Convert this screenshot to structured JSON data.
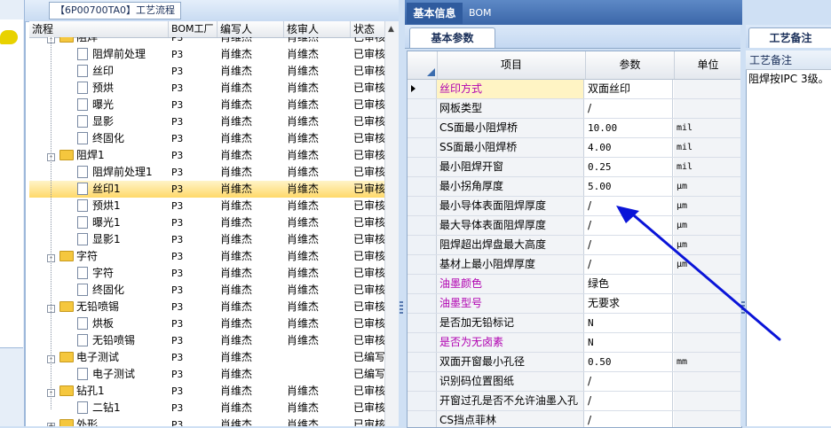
{
  "tree_panel": {
    "caption": "【6P00700TA0】工艺流程",
    "columns": [
      "流程",
      "BOM工厂",
      "编写人",
      "核审人",
      "状态"
    ],
    "rows": [
      {
        "level": 1,
        "type": "folder",
        "expand": "-",
        "name": "阻焊",
        "factory": "P3",
        "writer": "肖维杰",
        "reviewer": "肖维杰",
        "status": "已审核"
      },
      {
        "level": 2,
        "type": "doc",
        "name": "阻焊前处理",
        "factory": "P3",
        "writer": "肖维杰",
        "reviewer": "肖维杰",
        "status": "已审核"
      },
      {
        "level": 2,
        "type": "doc",
        "name": "丝印",
        "factory": "P3",
        "writer": "肖维杰",
        "reviewer": "肖维杰",
        "status": "已审核"
      },
      {
        "level": 2,
        "type": "doc",
        "name": "预烘",
        "factory": "P3",
        "writer": "肖维杰",
        "reviewer": "肖维杰",
        "status": "已审核"
      },
      {
        "level": 2,
        "type": "doc",
        "name": "曝光",
        "factory": "P3",
        "writer": "肖维杰",
        "reviewer": "肖维杰",
        "status": "已审核"
      },
      {
        "level": 2,
        "type": "doc",
        "name": "显影",
        "factory": "P3",
        "writer": "肖维杰",
        "reviewer": "肖维杰",
        "status": "已审核"
      },
      {
        "level": 2,
        "type": "doc",
        "name": "终固化",
        "factory": "P3",
        "writer": "肖维杰",
        "reviewer": "肖维杰",
        "status": "已审核"
      },
      {
        "level": 1,
        "type": "folder",
        "expand": "-",
        "name": "阻焊1",
        "factory": "P3",
        "writer": "肖维杰",
        "reviewer": "肖维杰",
        "status": "已审核"
      },
      {
        "level": 2,
        "type": "doc",
        "name": "阻焊前处理1",
        "factory": "P3",
        "writer": "肖维杰",
        "reviewer": "肖维杰",
        "status": "已审核"
      },
      {
        "level": 2,
        "type": "doc",
        "name": "丝印1",
        "factory": "P3",
        "writer": "肖维杰",
        "reviewer": "肖维杰",
        "status": "已审核",
        "selected": true
      },
      {
        "level": 2,
        "type": "doc",
        "name": "预烘1",
        "factory": "P3",
        "writer": "肖维杰",
        "reviewer": "肖维杰",
        "status": "已审核"
      },
      {
        "level": 2,
        "type": "doc",
        "name": "曝光1",
        "factory": "P3",
        "writer": "肖维杰",
        "reviewer": "肖维杰",
        "status": "已审核"
      },
      {
        "level": 2,
        "type": "doc",
        "name": "显影1",
        "factory": "P3",
        "writer": "肖维杰",
        "reviewer": "肖维杰",
        "status": "已审核"
      },
      {
        "level": 1,
        "type": "folder",
        "expand": "-",
        "name": "字符",
        "factory": "P3",
        "writer": "肖维杰",
        "reviewer": "肖维杰",
        "status": "已审核"
      },
      {
        "level": 2,
        "type": "doc",
        "name": "字符",
        "factory": "P3",
        "writer": "肖维杰",
        "reviewer": "肖维杰",
        "status": "已审核"
      },
      {
        "level": 2,
        "type": "doc",
        "name": "终固化",
        "factory": "P3",
        "writer": "肖维杰",
        "reviewer": "肖维杰",
        "status": "已审核"
      },
      {
        "level": 1,
        "type": "folder",
        "expand": "-",
        "name": "无铅喷锡",
        "factory": "P3",
        "writer": "肖维杰",
        "reviewer": "肖维杰",
        "status": "已审核"
      },
      {
        "level": 2,
        "type": "doc",
        "name": "烘板",
        "factory": "P3",
        "writer": "肖维杰",
        "reviewer": "肖维杰",
        "status": "已审核"
      },
      {
        "level": 2,
        "type": "doc",
        "name": "无铅喷锡",
        "factory": "P3",
        "writer": "肖维杰",
        "reviewer": "肖维杰",
        "status": "已审核"
      },
      {
        "level": 1,
        "type": "folder",
        "expand": "-",
        "name": "电子测试",
        "factory": "P3",
        "writer": "肖维杰",
        "reviewer": "",
        "status": "已编写"
      },
      {
        "level": 2,
        "type": "doc",
        "name": "电子测试",
        "factory": "P3",
        "writer": "肖维杰",
        "reviewer": "",
        "status": "已编写"
      },
      {
        "level": 1,
        "type": "folder",
        "expand": "-",
        "name": "钻孔1",
        "factory": "P3",
        "writer": "肖维杰",
        "reviewer": "肖维杰",
        "status": "已审核"
      },
      {
        "level": 2,
        "type": "doc",
        "name": "二钻1",
        "factory": "P3",
        "writer": "肖维杰",
        "reviewer": "肖维杰",
        "status": "已审核"
      },
      {
        "level": 1,
        "type": "folder",
        "expand": "+",
        "name": "外形",
        "factory": "P3",
        "writer": "肖维杰",
        "reviewer": "肖维杰",
        "status": "已审核"
      }
    ]
  },
  "main_panel": {
    "tabs": [
      "基本信息",
      "BOM"
    ],
    "active_tab": "基本信息",
    "sub_tab": "基本参数",
    "columns": [
      "项目",
      "参数",
      "单位"
    ],
    "rows": [
      {
        "item": "丝印方式",
        "param": "双面丝印",
        "unit": "",
        "color": "#b000b0",
        "current": true,
        "highlight": true
      },
      {
        "item": "网板类型",
        "param": "/",
        "unit": ""
      },
      {
        "item": "CS面最小阻焊桥",
        "param": "10.00",
        "unit": "mil",
        "mono": true
      },
      {
        "item": "SS面最小阻焊桥",
        "param": "4.00",
        "unit": "mil",
        "mono": true
      },
      {
        "item": "最小阻焊开窗",
        "param": "0.25",
        "unit": "mil",
        "mono": true
      },
      {
        "item": "最小拐角厚度",
        "param": "5.00",
        "unit": "μm",
        "mono": true
      },
      {
        "item": "最小导体表面阻焊厚度",
        "param": "/",
        "unit": "μm"
      },
      {
        "item": "最大导体表面阻焊厚度",
        "param": "/",
        "unit": "μm"
      },
      {
        "item": "阻焊超出焊盘最大高度",
        "param": "/",
        "unit": "μm"
      },
      {
        "item": "基材上最小阻焊厚度",
        "param": "/",
        "unit": "μm"
      },
      {
        "item": "油墨颜色",
        "param": "绿色",
        "unit": "",
        "color": "#b000b0"
      },
      {
        "item": "油墨型号",
        "param": "无要求",
        "unit": "",
        "color": "#b000b0"
      },
      {
        "item": "是否加无铅标记",
        "param": "N",
        "unit": "",
        "mono": true
      },
      {
        "item": "是否为无卤素",
        "param": "N",
        "unit": "",
        "color": "#b000b0",
        "mono": true
      },
      {
        "item": "双面开窗最小孔径",
        "param": "0.50",
        "unit": "mm",
        "mono": true
      },
      {
        "item": "识别码位置图纸",
        "param": "/",
        "unit": ""
      },
      {
        "item": "开窗过孔是否不允许油墨入孔",
        "param": "/",
        "unit": ""
      },
      {
        "item": "CS挡点菲林",
        "param": "/",
        "unit": ""
      }
    ]
  },
  "right_panel": {
    "tab": "工艺备注",
    "header": "工艺备注",
    "text": "阻焊按IPC 3级。"
  },
  "colors": {
    "arrow": "#0a14d8",
    "selection": "#ffd96a",
    "tab_active": "#2f5b9e",
    "magenta_label": "#b000b0"
  }
}
